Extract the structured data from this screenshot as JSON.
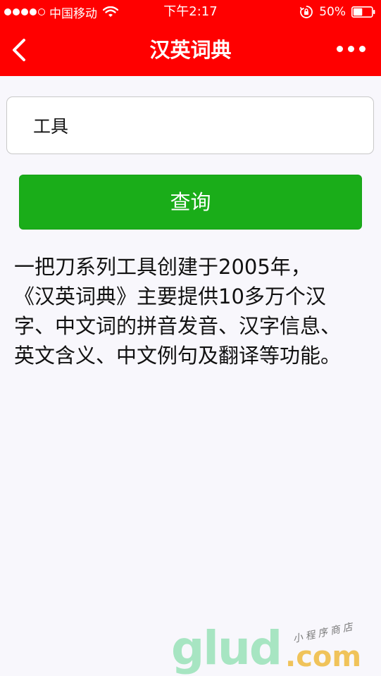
{
  "status_bar": {
    "carrier": "中国移动",
    "time": "下午2:17",
    "battery_percent": "50%",
    "battery_level": 0.5
  },
  "nav": {
    "title": "汉英词典"
  },
  "search": {
    "value": "工具"
  },
  "query_button": {
    "label": "查询"
  },
  "description": "一把刀系列工具创建于2005年，\n《汉英词典》主要提供10多万个汉字、中文词的拼音发音、汉字信息、英文含义、中文例句及翻译等功能。",
  "watermark": {
    "logo": "glud",
    "domain": ".com",
    "tagline": "小程序商店"
  },
  "colors": {
    "header": "#ff0000",
    "button": "#1aad19",
    "background": "#f8f7fc"
  }
}
